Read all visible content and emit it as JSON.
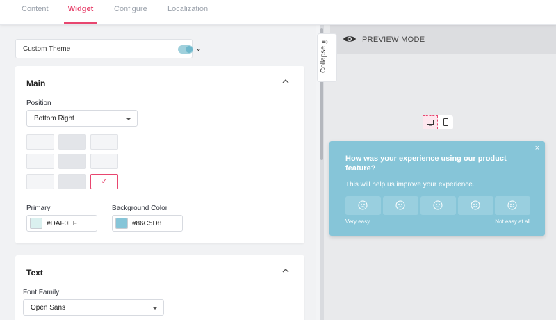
{
  "tabs": [
    {
      "label": "Content",
      "active": false
    },
    {
      "label": "Widget",
      "active": true
    },
    {
      "label": "Configure",
      "active": false
    },
    {
      "label": "Localization",
      "active": false
    }
  ],
  "theme": {
    "label": "Custom Theme"
  },
  "main": {
    "title": "Main",
    "position_label": "Position",
    "position_value": "Bottom Right",
    "selected_mark": "✓",
    "primary_label": "Primary",
    "primary_hex": "#DAF0EF",
    "bg_label": "Background Color",
    "bg_hex": "#86C5D8"
  },
  "text_section": {
    "title": "Text",
    "font_family_label": "Font Family",
    "font_family_value": "Open Sans"
  },
  "sidebar": {
    "collapse_label": "Collapse"
  },
  "preview": {
    "title": "PREVIEW MODE",
    "widget": {
      "question": "How was your experience using our product feature?",
      "subtitle": "This will help us improve your experience.",
      "scale_left": "Very easy",
      "scale_right": "Not easy at all",
      "close": "×"
    }
  },
  "colors": {
    "accent": "#e8466f",
    "primary": "#DAF0EF",
    "background": "#86C5D8"
  }
}
